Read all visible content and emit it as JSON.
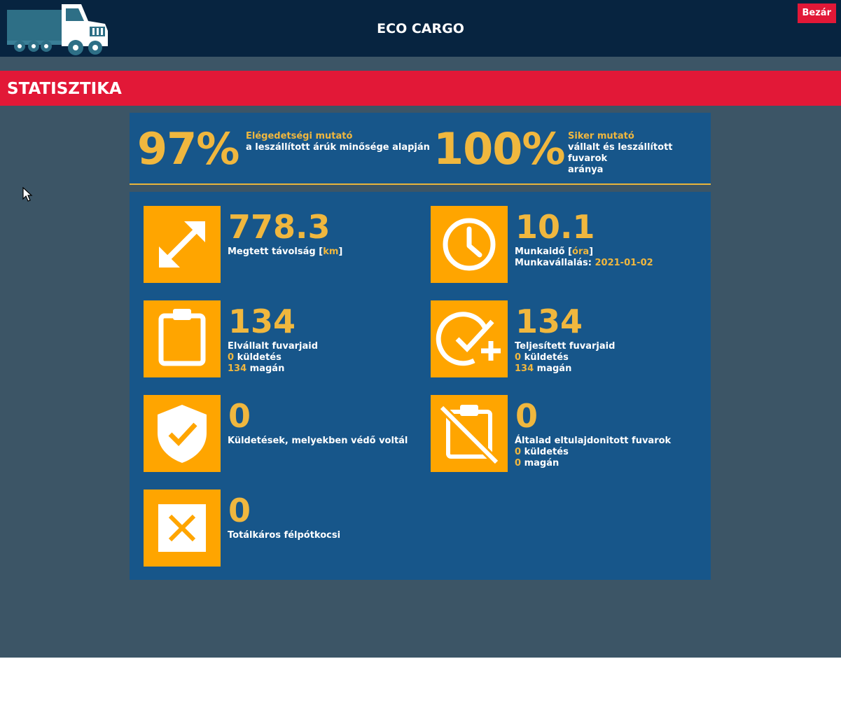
{
  "header": {
    "title": "ECO CARGO",
    "close_label": "Bezár"
  },
  "section": {
    "title": "STATISZTIKA"
  },
  "summary": {
    "satisfaction": {
      "value": "97%",
      "label": "Elégedetségi mutató",
      "desc": "a leszállított árúk minősége alapján"
    },
    "success": {
      "value": "100%",
      "label": "Siker mutató",
      "desc_line1": "vállalt és leszállított fuvarok",
      "desc_line2": "aránya"
    }
  },
  "stats": {
    "distance": {
      "value": "778.3",
      "label": "Megtett távolság [",
      "unit": "km",
      "label_end": "]",
      "icon": "resize-arrows-icon"
    },
    "worktime": {
      "value": "10.1",
      "label": "Munkaidő [",
      "unit": "óra",
      "label_end": "]",
      "since_label": "Munkavállalás: ",
      "since_value": "2021-01-02",
      "icon": "clock-icon"
    },
    "accepted": {
      "value": "134",
      "label": "Elvállalt fuvarjaid",
      "missions_count": "0",
      "missions_label": " küldetés",
      "private_count": "134",
      "private_label": " magán",
      "icon": "clipboard-icon"
    },
    "completed": {
      "value": "134",
      "label": "Teljesített fuvarjaid",
      "missions_count": "0",
      "missions_label": " küldetés",
      "private_count": "134",
      "private_label": " magán",
      "icon": "check-plus-icon"
    },
    "defender": {
      "value": "0",
      "label": "Küldetések, melyekben védő voltál",
      "icon": "shield-check-icon"
    },
    "stolen": {
      "value": "0",
      "label": "Általad eltulajdonitott fuvarok",
      "missions_count": "0",
      "missions_label": " küldetés",
      "private_count": "0",
      "private_label": " magán",
      "icon": "clipboard-off-icon"
    },
    "wrecked": {
      "value": "0",
      "label": "Totálkáros félpótkocsi",
      "icon": "close-box-icon"
    }
  },
  "colors": {
    "accent": "#f0b73e",
    "tile": "#ffa500",
    "panel": "#17568a",
    "header": "#072440",
    "red": "#e21837",
    "background": "#3c5566"
  }
}
